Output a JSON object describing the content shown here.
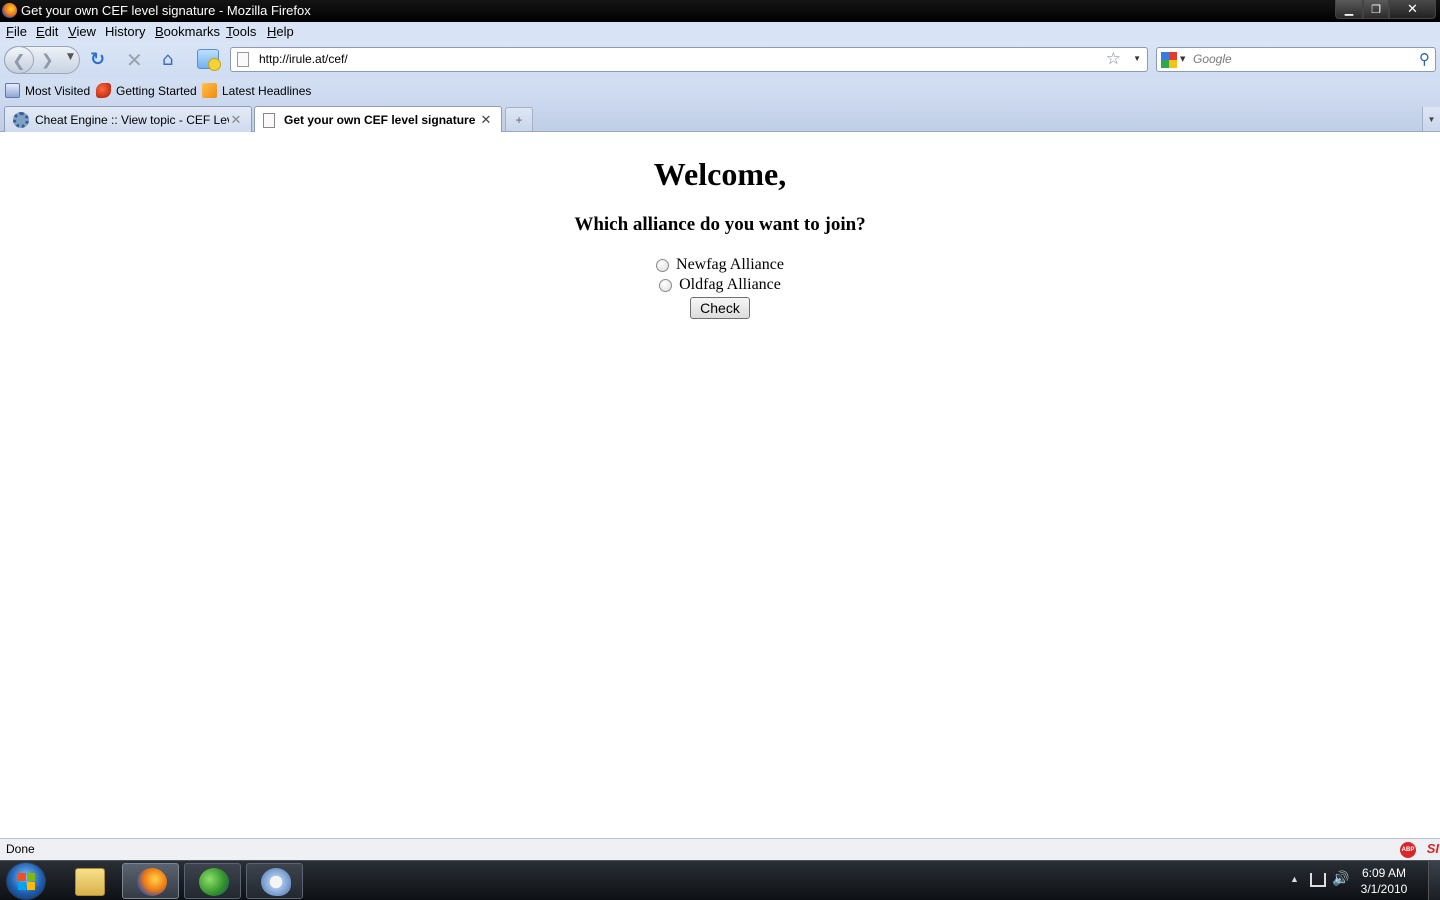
{
  "window": {
    "title": "Get your own CEF level signature - Mozilla Firefox",
    "minimize_glyph": "▁",
    "maximize_glyph": "❐",
    "close_glyph": "✕"
  },
  "menu": {
    "items": [
      {
        "accel": "F",
        "rest": "ile"
      },
      {
        "accel": "E",
        "rest": "dit"
      },
      {
        "accel": "V",
        "rest": "iew"
      },
      {
        "accel": "H",
        "rest": "istory",
        "pre": ""
      },
      {
        "accel": "B",
        "rest": "ookmarks"
      },
      {
        "accel": "T",
        "rest": "ools"
      },
      {
        "accel": "H",
        "rest": "elp"
      }
    ]
  },
  "navigation": {
    "url": "http://irule.at/cef/",
    "search_placeholder": "Google",
    "icons": [
      "back-icon",
      "forward-icon",
      "reload-icon",
      "stop-icon",
      "home-icon",
      "addon-icon",
      "bookmark-star-icon",
      "search-engine-icon",
      "magnifier-icon"
    ]
  },
  "bookmarks": {
    "items": [
      {
        "label": "Most Visited",
        "icon": "most-visited-icon"
      },
      {
        "label": "Getting Started",
        "icon": "getting-started-icon"
      },
      {
        "label": "Latest Headlines",
        "icon": "rss-icon"
      }
    ]
  },
  "tabs": [
    {
      "label": "Cheat Engine :: View topic - CEF Lev...",
      "active": false
    },
    {
      "label": "Get your own CEF level signature",
      "active": true
    }
  ],
  "page": {
    "heading": "Welcome,",
    "question": "Which alliance do you want to join?",
    "options": [
      "Newfag Alliance",
      "Oldfag Alliance"
    ],
    "submit_label": "Check"
  },
  "status": {
    "text": "Done",
    "addons": [
      "adblock-icon",
      "si-icon"
    ],
    "abp_label": "ABP",
    "si_label": "SI"
  },
  "taskbar": {
    "apps": [
      "windows-explorer",
      "firefox",
      "windows-live-messenger",
      "paint"
    ],
    "time": "6:09 AM",
    "date": "3/1/2010"
  }
}
